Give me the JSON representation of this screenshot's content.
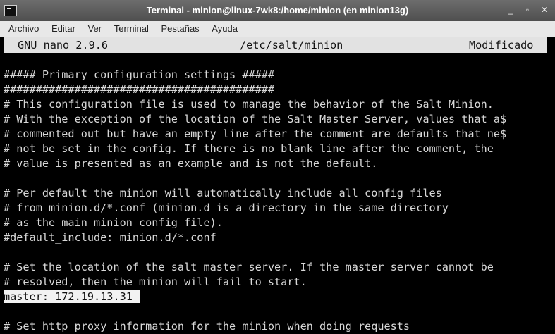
{
  "window": {
    "title": "Terminal - minion@linux-7wk8:/home/minion (en minion13g)",
    "controls": [
      "_",
      "▫",
      "✕"
    ]
  },
  "menu": [
    "Archivo",
    "Editar",
    "Ver",
    "Terminal",
    "Pestañas",
    "Ayuda"
  ],
  "nano": {
    "version": "GNU nano 2.9.6",
    "file": "/etc/salt/minion",
    "status": "Modificado"
  },
  "lines": [
    "##### Primary configuration settings #####",
    "##########################################",
    "# This configuration file is used to manage the behavior of the Salt Minion.",
    "# With the exception of the location of the Salt Master Server, values that a$",
    "# commented out but have an empty line after the comment are defaults that ne$",
    "# not be set in the config. If there is no blank line after the comment, the",
    "# value is presented as an example and is not the default.",
    "",
    "# Per default the minion will automatically include all config files",
    "# from minion.d/*.conf (minion.d is a directory in the same directory",
    "# as the main minion config file).",
    "#default_include: minion.d/*.conf",
    "",
    "# Set the location of the salt master server. If the master server cannot be",
    "# resolved, then the minion will fail to start.",
    "master: 172.19.13.31",
    "",
    "# Set http proxy information for the minion when doing requests"
  ]
}
